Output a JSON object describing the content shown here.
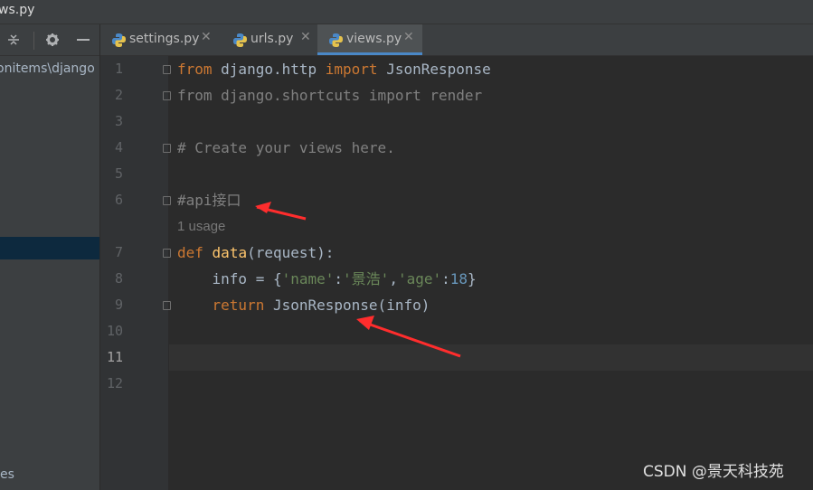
{
  "window": {
    "title_fragment": "ws.py"
  },
  "sidebar": {
    "path_fragment": "onitems\\django",
    "bottom_fragment": "es",
    "icons": [
      "collapse-all-icon",
      "gear-icon",
      "hide-icon"
    ]
  },
  "tabs": [
    {
      "label": "settings.py",
      "icon": "python-file-icon",
      "active": false
    },
    {
      "label": "urls.py",
      "icon": "python-file-icon",
      "active": false
    },
    {
      "label": "views.py",
      "icon": "python-file-icon",
      "active": true
    }
  ],
  "editor": {
    "current_line": "11",
    "line_numbers": [
      "1",
      "2",
      "3",
      "4",
      "5",
      "6",
      "7",
      "8",
      "9",
      "10",
      "11",
      "12"
    ],
    "usage_hint": "1 usage",
    "code": {
      "l1": {
        "kw1": "from",
        "mod": " django.http ",
        "kw2": "import",
        "name": " JsonResponse"
      },
      "l2": "from django.shortcuts import render",
      "l4": "# Create your views here.",
      "l6": "#api接口",
      "l7": {
        "kw": "def",
        "fn": "data",
        "rest": "(request):"
      },
      "l8": {
        "indent": "    info = {",
        "k1": "'name'",
        "c1": ":",
        "v1": "'景浩'",
        "c2": ",",
        "k2": "'age'",
        "c3": ":",
        "v2": "18",
        "end": "}"
      },
      "l9": {
        "indent": "    ",
        "kw": "return",
        "rest": " JsonResponse(info)"
      }
    }
  },
  "annotations": [
    "red-arrow",
    "red-arrow"
  ],
  "watermark": "CSDN @景天科技苑",
  "colors": {
    "background": "#2b2b2b",
    "panel": "#3c3f41",
    "keyword": "#cc7832",
    "comment": "#808080",
    "function": "#ffc66d",
    "string": "#6a8759",
    "number": "#6897bb",
    "tab_accent": "#4a88c7",
    "arrow": "#ff2d2d"
  }
}
